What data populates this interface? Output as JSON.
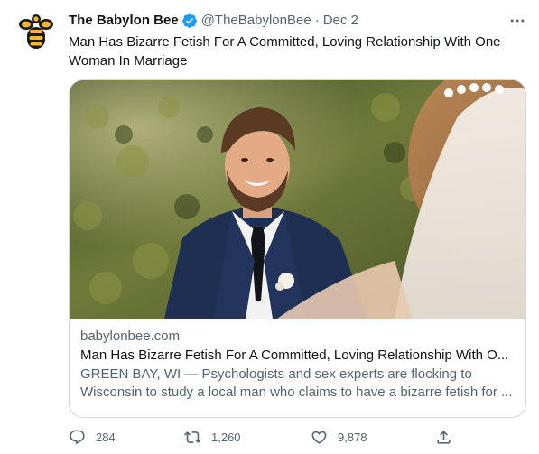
{
  "author": {
    "name": "The Babylon Bee",
    "handle": "@TheBabylonBee",
    "separator": "·",
    "date": "Dec 2",
    "avatar_icon": "bee-logo-icon",
    "verified_icon": "verified-badge-icon"
  },
  "tweet": {
    "text": "Man Has Bizarre Fetish For A Committed, Loving Relationship With One Woman In Marriage"
  },
  "card": {
    "image_icon": "wedding-photo",
    "domain": "babylonbee.com",
    "title": "Man Has Bizarre Fetish For A Committed, Loving Relationship With O...",
    "description": "GREEN BAY, WI — Psychologists and sex experts are flocking to Wisconsin to study a local man who claims to have a bizarre fetish for ..."
  },
  "actions": {
    "replies": "284",
    "retweets": "1,260",
    "likes": "9,878"
  },
  "colors": {
    "accent": "#1d9bf0",
    "text_secondary": "#536471",
    "border": "#cfd9de",
    "logo_yellow": "#f5b82e"
  }
}
